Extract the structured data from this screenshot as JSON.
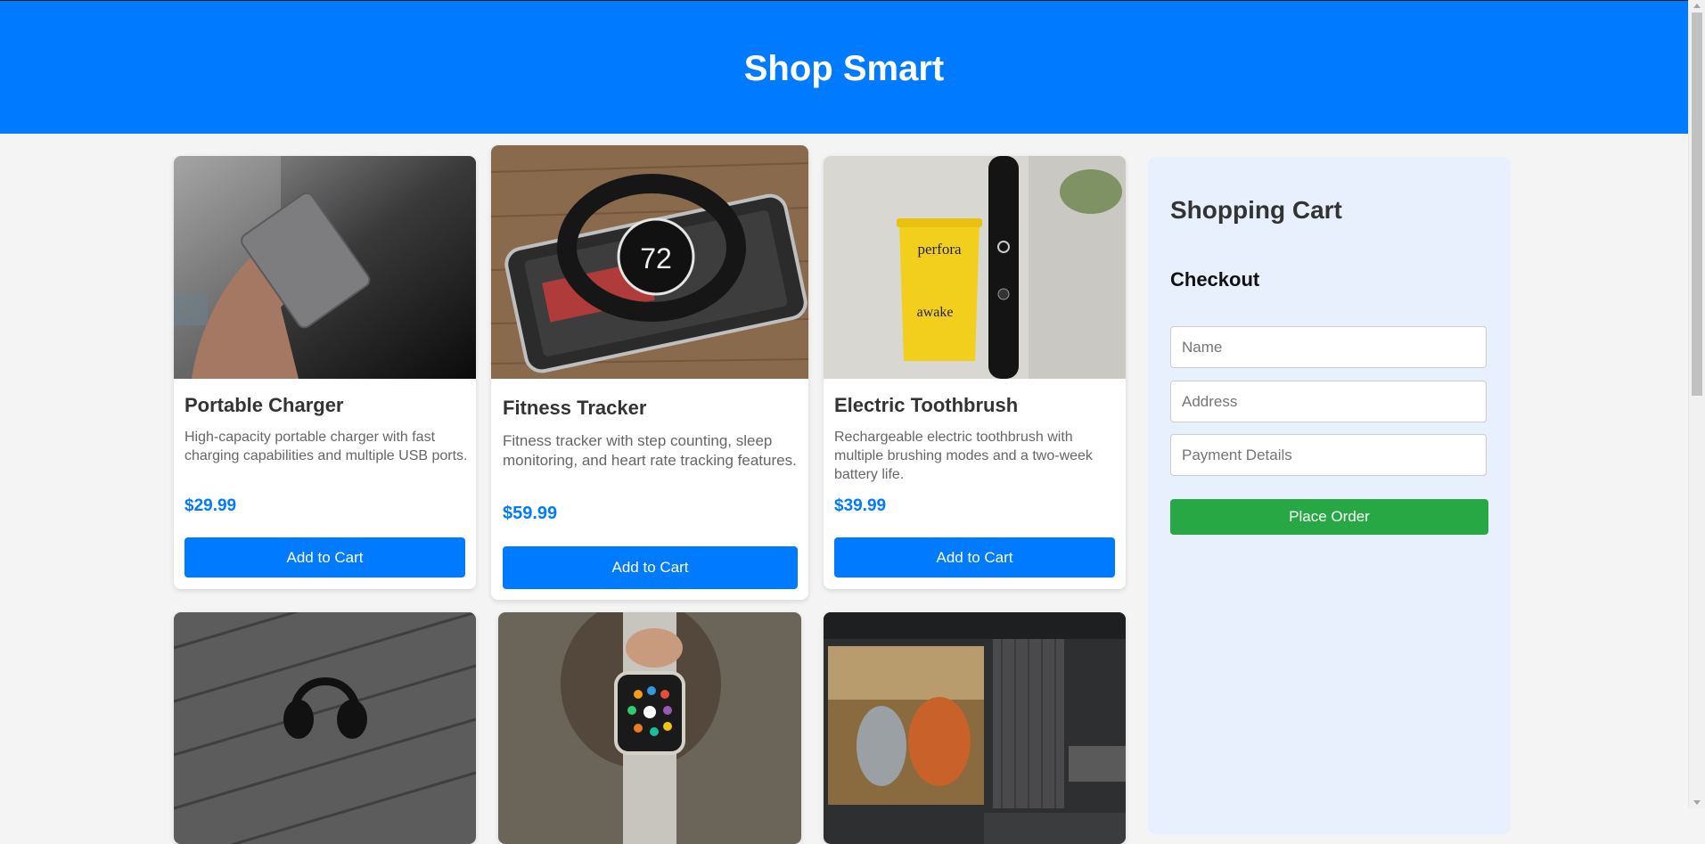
{
  "header": {
    "title": "Shop Smart"
  },
  "products": [
    {
      "name": "Portable Charger",
      "description": "High-capacity portable charger with fast charging capabilities and multiple USB ports.",
      "price": "$29.99",
      "button": "Add to Cart",
      "image": "portable-charger-photo"
    },
    {
      "name": "Fitness Tracker",
      "description": "Fitness tracker with step counting, sleep monitoring, and heart rate tracking features.",
      "price": "$59.99",
      "button": "Add to Cart",
      "image": "fitness-tracker-photo"
    },
    {
      "name": "Electric Toothbrush",
      "description": "Rechargeable electric toothbrush with multiple brushing modes and a two-week battery life.",
      "price": "$39.99",
      "button": "Add to Cart",
      "image": "electric-toothbrush-photo"
    },
    {
      "image": "headphones-photo"
    },
    {
      "image": "smartwatch-photo"
    },
    {
      "image": "home-theater-photo"
    }
  ],
  "cart": {
    "title": "Shopping Cart",
    "checkout_title": "Checkout",
    "name_placeholder": "Name",
    "address_placeholder": "Address",
    "payment_placeholder": "Payment Details",
    "order_button": "Place Order"
  },
  "colors": {
    "primary": "#007bff",
    "success": "#28a745",
    "cart_bg": "#e8f0fd",
    "page_bg": "#f4f4f4"
  }
}
